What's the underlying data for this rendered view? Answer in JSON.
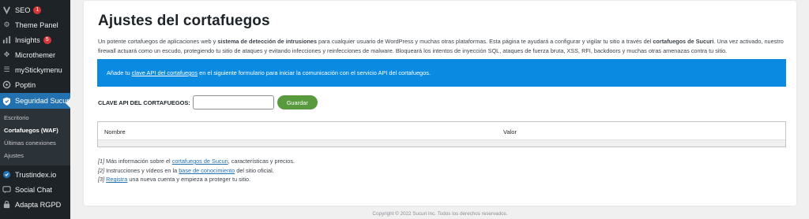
{
  "sidebar": {
    "items": [
      {
        "label": "SEO",
        "icon": "seo-icon",
        "badge": "1"
      },
      {
        "label": "Theme Panel",
        "icon": "theme-panel-icon"
      },
      {
        "label": "Insights",
        "icon": "insights-icon",
        "badge": "5"
      },
      {
        "label": "Microthemer",
        "icon": "microthemer-icon"
      },
      {
        "label": "myStickymenu",
        "icon": "sticky-menu-icon"
      },
      {
        "label": "Poptin",
        "icon": "poptin-icon"
      },
      {
        "label": "Seguridad Sucuri",
        "icon": "shield-icon"
      }
    ],
    "submenu": [
      "Escritorio",
      "Cortafuegos (WAF)",
      "Últimas conexiones",
      "Ajustes"
    ],
    "after": [
      {
        "label": "Trustindex.io",
        "icon": "trustindex-icon"
      },
      {
        "label": "Social Chat",
        "icon": "chat-icon"
      },
      {
        "label": "Adapta RGPD",
        "icon": "gdpr-icon"
      }
    ]
  },
  "page": {
    "title": "Ajustes del cortafuegos",
    "intro": {
      "p1": "Un potente cortafuegos de aplicaciones web y ",
      "b1": "sistema de detección de intrusiones",
      "p2": " para cualquier usuario de WordPress y muchas otras plataformas. Esta página te ayudará a configurar y vigilar tu sitio a través del ",
      "b2": "cortafuegos de Sucuri",
      "p3": ". Una vez activado, nuestro firewall actuará como un escudo, protegiendo tu sitio de ataques y evitando infecciones y reinfecciones de malware. Bloqueará los intentos de inyección SQL, ataques de fuerza bruta, XSS, RFI, backdoors y muchas otras amenazas contra tu sitio."
    },
    "notice": {
      "before": "Añade tu ",
      "link": "clave API del cortafuegos",
      "after": " en el siguiente formulario para iniciar la comunicación con el servicio API del cortafuegos."
    },
    "form": {
      "label": "CLAVE API DEL CORTAFUEGOS:",
      "input_value": "",
      "button": "Guardar"
    },
    "table": {
      "headers": [
        "Nombre",
        "Valor"
      ]
    },
    "notes": [
      {
        "num": "[1]",
        "before": " Más información sobre el ",
        "link": "cortafuegos de Sucuri",
        "after": ", características y precios."
      },
      {
        "num": "[2]",
        "before": " Instrucciones y vídeos en la ",
        "link": "base de conocimiento",
        "after": " del sitio oficial."
      },
      {
        "num": "[3]",
        "before": " ",
        "link": "Registra",
        "after": " una nueva cuenta y empieza a proteger tu sitio."
      }
    ],
    "footer": "Copyright © 2022 Sucuri Inc. Todos los derechos reservados."
  },
  "colors": {
    "sidebar_bg": "#1d2327",
    "active": "#2271b1",
    "notice_bg": "#0a8ae0",
    "save_button": "#5a9a3f",
    "badge": "#d63638"
  }
}
